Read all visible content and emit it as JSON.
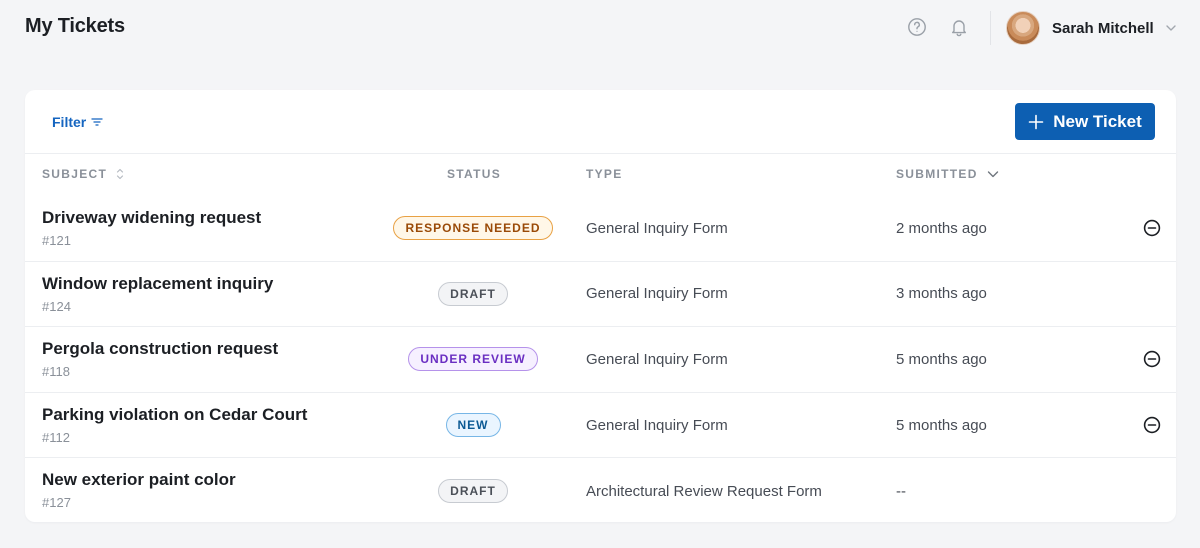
{
  "header": {
    "title": "My Tickets",
    "help_icon": "help-circle-icon",
    "bell_icon": "bell-icon",
    "user": {
      "name": "Sarah Mitchell"
    }
  },
  "toolbar": {
    "filter_label": "Filter",
    "new_ticket_label": "New Ticket",
    "accent_color": "#0d5fb2"
  },
  "table": {
    "columns": {
      "subject": "SUBJECT",
      "status": "STATUS",
      "type": "TYPE",
      "submitted": "SUBMITTED"
    },
    "rows": [
      {
        "subject": "Driveway widening request",
        "id": "#121",
        "status": "RESPONSE NEEDED",
        "status_variant": "response",
        "type": "General Inquiry Form",
        "submitted": "2 months ago",
        "has_action": true
      },
      {
        "subject": "Window replacement inquiry",
        "id": "#124",
        "status": "DRAFT",
        "status_variant": "draft",
        "type": "General Inquiry Form",
        "submitted": "3 months ago",
        "has_action": false
      },
      {
        "subject": "Pergola construction request",
        "id": "#118",
        "status": "UNDER REVIEW",
        "status_variant": "review",
        "type": "General Inquiry Form",
        "submitted": "5 months ago",
        "has_action": true
      },
      {
        "subject": "Parking violation on Cedar Court",
        "id": "#112",
        "status": "NEW",
        "status_variant": "new",
        "type": "General Inquiry Form",
        "submitted": "5 months ago",
        "has_action": true
      },
      {
        "subject": "New exterior paint color",
        "id": "#127",
        "status": "DRAFT",
        "status_variant": "draft",
        "type": "Architectural Review Request Form",
        "submitted": "--",
        "has_action": false
      }
    ]
  }
}
